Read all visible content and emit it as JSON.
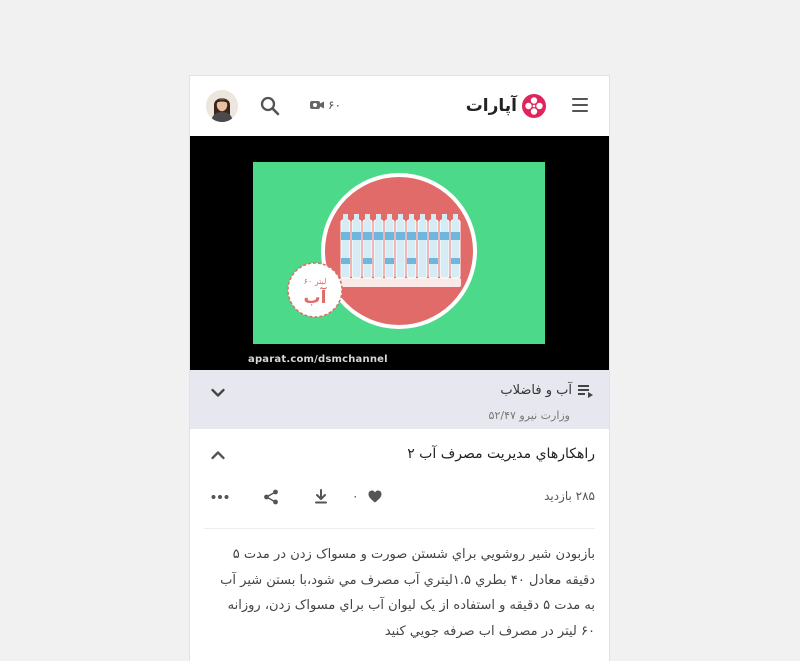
{
  "header": {
    "logo_text": "آپارات",
    "credit_count": "۶۰",
    "icons": {
      "menu": "hamburger-icon",
      "search": "search-icon",
      "credit": "camera-icon",
      "logo": "aparat-logo-icon"
    }
  },
  "player": {
    "watermark": "aparat.com/dsmchannel",
    "badge_top": "۶۰ لیتر",
    "badge_bottom": "آب",
    "colors": {
      "background": "#4cd98a",
      "circle": "#e06b68"
    }
  },
  "playlist": {
    "title": "آب و فاضلاب",
    "subtitle": "وزارت نیرو ۵۲/۴۷",
    "icons": {
      "playlist": "playlist-icon",
      "toggle": "chevron-down-icon"
    }
  },
  "video": {
    "title": "راهکارهاي مديريت مصرف آب ۲",
    "views": "۲۸۵ بازدید",
    "likes": "۰",
    "description": "بازبودن شير روشويي براي شستن صورت و مسواک زدن در مدت ۵ دقيقه معادل ۴۰ بطري ۱.۵ليتري آب مصرف مي شود،با بستن شير آب به مدت ۵ دقيقه و استفاده از يک ليوان آب براي مسواک زدن، روزانه ۶۰ ليتر در مصرف اب صرفه جويي کنيد",
    "icons": {
      "collapse": "chevron-up-icon",
      "like": "heart-icon",
      "download": "download-icon",
      "share": "share-icon",
      "more": "more-icon"
    }
  }
}
